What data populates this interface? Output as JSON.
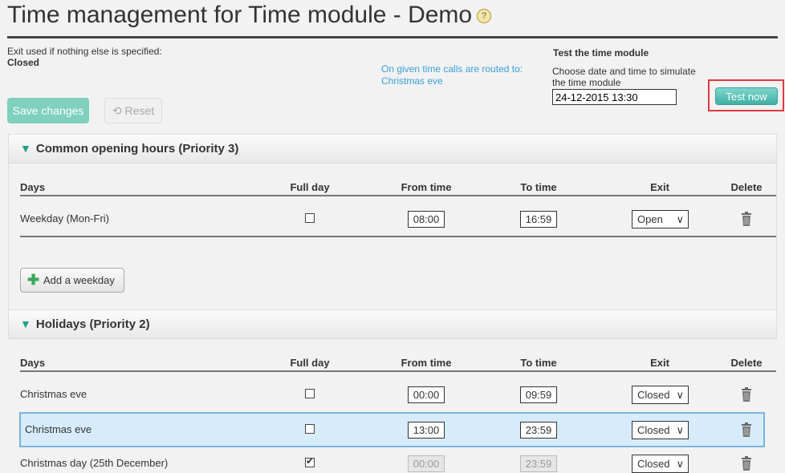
{
  "title": "Time management for Time module - Demo",
  "help_icon": "?",
  "default_exit": {
    "label": "Exit used if nothing else is specified:",
    "value": "Closed"
  },
  "routing": {
    "label": "On given time calls are routed to:",
    "value": "Christmas eve"
  },
  "test": {
    "heading": "Test the time module",
    "desc_line1": "Choose date and time to simulate",
    "desc_line2": "the time module",
    "datetime": "24-12-2015 13:30",
    "button": "Test now"
  },
  "actions": {
    "save": "Save changes",
    "reset": "Reset"
  },
  "columns": {
    "days": "Days",
    "full_day": "Full day",
    "from": "From time",
    "to": "To time",
    "exit": "Exit",
    "delete": "Delete"
  },
  "sections": [
    {
      "title": "Common opening hours (Priority 3)",
      "rows": [
        {
          "day": "Weekday (Mon-Fri)",
          "full_day": false,
          "from": "08:00",
          "to": "16:59",
          "exit": "Open"
        }
      ],
      "add_label": "Add a weekday"
    },
    {
      "title": "Holidays (Priority 2)",
      "rows": [
        {
          "day": "Christmas eve",
          "full_day": false,
          "from": "00:00",
          "to": "09:59",
          "exit": "Closed"
        },
        {
          "day": "Christmas eve",
          "full_day": false,
          "from": "13:00",
          "to": "23:59",
          "exit": "Closed",
          "highlighted": true
        },
        {
          "day": "Christmas day (25th December)",
          "full_day": true,
          "from": "00:00",
          "to": "23:59",
          "exit": "Closed"
        }
      ]
    }
  ],
  "colors": {
    "accent": "#21a08a",
    "link": "#3aa0dd",
    "highlight": "#d6ecfb",
    "focus_outline": "#e0393e"
  }
}
